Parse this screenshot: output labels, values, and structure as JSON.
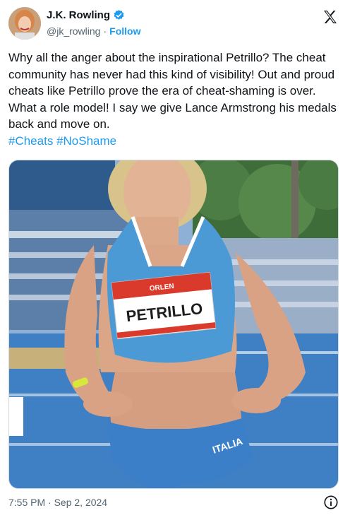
{
  "author": {
    "display_name": "J.K. Rowling",
    "handle": "@jk_rowling",
    "separator": "·",
    "follow_label": "Follow",
    "verified": true
  },
  "icons": {
    "verified": "verified-badge-icon",
    "brand": "x-logo-icon",
    "info": "info-icon"
  },
  "tweet": {
    "text": "Why all the anger about the inspirational Petrillo? The cheat community has never had this kind of visibility! Out and proud cheats like Petrillo prove the era of cheat-shaming is over. What a role model! I say we give Lance Armstrong his medals back and move on.",
    "hashtags": [
      "#Cheats",
      "#NoShame"
    ]
  },
  "media": {
    "bib_name": "PETRILLO",
    "bib_sponsor": "ORLEN",
    "shorts_text": "ITALIA"
  },
  "footer": {
    "timestamp": "7:55 PM · Sep 2, 2024"
  },
  "colors": {
    "link": "#1d9bf0",
    "text": "#0f1419",
    "muted": "#536471",
    "jersey": "#4b9ad6"
  }
}
